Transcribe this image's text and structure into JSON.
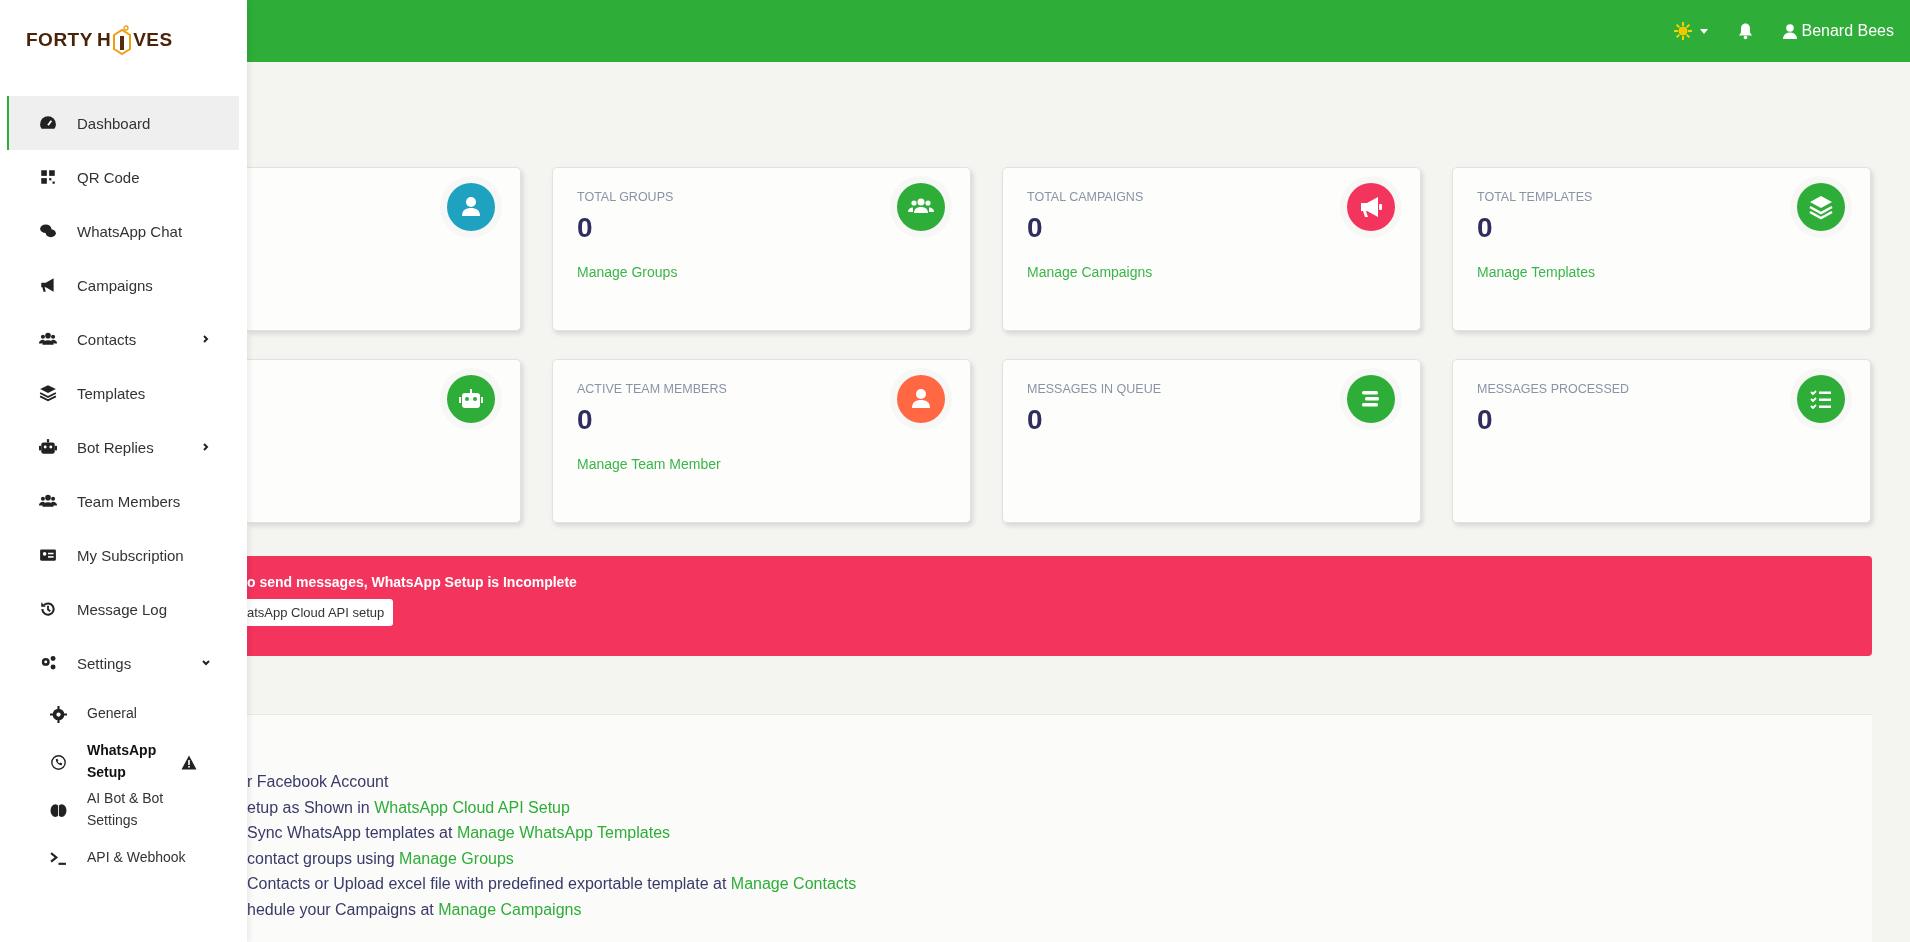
{
  "logo": {
    "left": "FORTY",
    "middle": "H",
    "right": "VES"
  },
  "sidebar": {
    "items": [
      {
        "label": "Dashboard",
        "selected": true
      },
      {
        "label": "QR Code",
        "selected": false
      },
      {
        "label": "WhatsApp Chat",
        "selected": false
      },
      {
        "label": "Campaigns",
        "selected": false
      },
      {
        "label": "Contacts",
        "selected": false,
        "expanded": false
      },
      {
        "label": "Templates",
        "selected": false
      },
      {
        "label": "Bot Replies",
        "selected": false,
        "expanded": false
      },
      {
        "label": "Team Members",
        "selected": false
      },
      {
        "label": "My Subscription",
        "selected": false
      },
      {
        "label": "Message Log",
        "selected": false
      },
      {
        "label": "Settings",
        "selected": false,
        "expanded": true,
        "children": [
          {
            "label": "General",
            "selected": false,
            "warning": false
          },
          {
            "label": "WhatsApp Setup",
            "selected": true,
            "warning": true
          },
          {
            "label": "AI Bot & Bot Settings",
            "selected": false,
            "warning": false
          },
          {
            "label": "API & Webhook",
            "selected": false,
            "warning": false
          }
        ]
      }
    ]
  },
  "topbar": {
    "dark_mode": false,
    "user": "Benard Bees"
  },
  "stat_cards": [
    {
      "color": "#1fa2c0"
    },
    {
      "label": "TOTAL GROUPS",
      "value": "0",
      "link": "Manage Groups",
      "color": "#2ead38"
    },
    {
      "label": "TOTAL CAMPAIGNS",
      "value": "0",
      "link": "Manage Campaigns",
      "color": "#f3345d"
    },
    {
      "label": "TOTAL TEMPLATES",
      "value": "0",
      "link": "Manage Templates",
      "color": "#2ead38"
    },
    {
      "color": "#2ead38"
    },
    {
      "label": "ACTIVE TEAM MEMBERS",
      "value": "0",
      "link": "Manage Team Member",
      "color": "#ff6843"
    },
    {
      "label": "MESSAGES IN QUEUE",
      "value": "0",
      "color": "#2ead38"
    },
    {
      "label": "MESSAGES PROCESSED",
      "value": "0",
      "color": "#2ead38"
    }
  ],
  "alert": {
    "message": "o send messages, WhatsApp Setup is Incomplete",
    "button": "atsApp Cloud API setup"
  },
  "instructions": [
    {
      "text": "r Facebook Account"
    },
    {
      "text": "etup as Shown in ",
      "link": "WhatsApp Cloud API Setup"
    },
    {
      "text": "Sync WhatsApp templates at ",
      "link": "Manage WhatsApp Templates"
    },
    {
      "text": "contact groups using ",
      "link": "Manage Groups"
    },
    {
      "text": "Contacts or Upload excel file with predefined exportable template at ",
      "link": "Manage Contacts"
    },
    {
      "text": "hedule your Campaigns at ",
      "link": "Manage Campaigns"
    }
  ]
}
